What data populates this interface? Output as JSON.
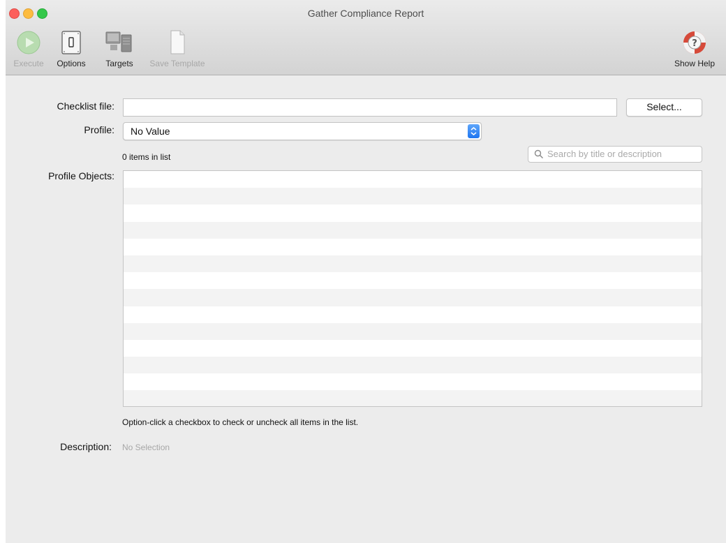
{
  "window": {
    "title": "Gather Compliance Report"
  },
  "toolbar": {
    "execute_label": "Execute",
    "options_label": "Options",
    "targets_label": "Targets",
    "save_template_label": "Save Template",
    "show_help_label": "Show Help",
    "icons": {
      "execute": "play-icon",
      "options": "options-switch-icon",
      "targets": "targets-computers-icon",
      "save_template": "document-icon",
      "show_help": "lifebuoy-help-icon"
    }
  },
  "form": {
    "checklist_label": "Checklist file:",
    "checklist_value": "",
    "select_button": "Select...",
    "profile_label": "Profile:",
    "profile_value": "No Value",
    "items_count": "0 items in list",
    "search_placeholder": "Search by title or description",
    "profile_objects_label": "Profile Objects:",
    "hint": "Option-click a checkbox to check or uncheck all items in the list.",
    "description_label": "Description:",
    "description_value": "No Selection"
  },
  "colors": {
    "accent": "#1e75f0",
    "close": "#fc605c",
    "minimize": "#fdbc40",
    "maximize": "#34c84a"
  }
}
